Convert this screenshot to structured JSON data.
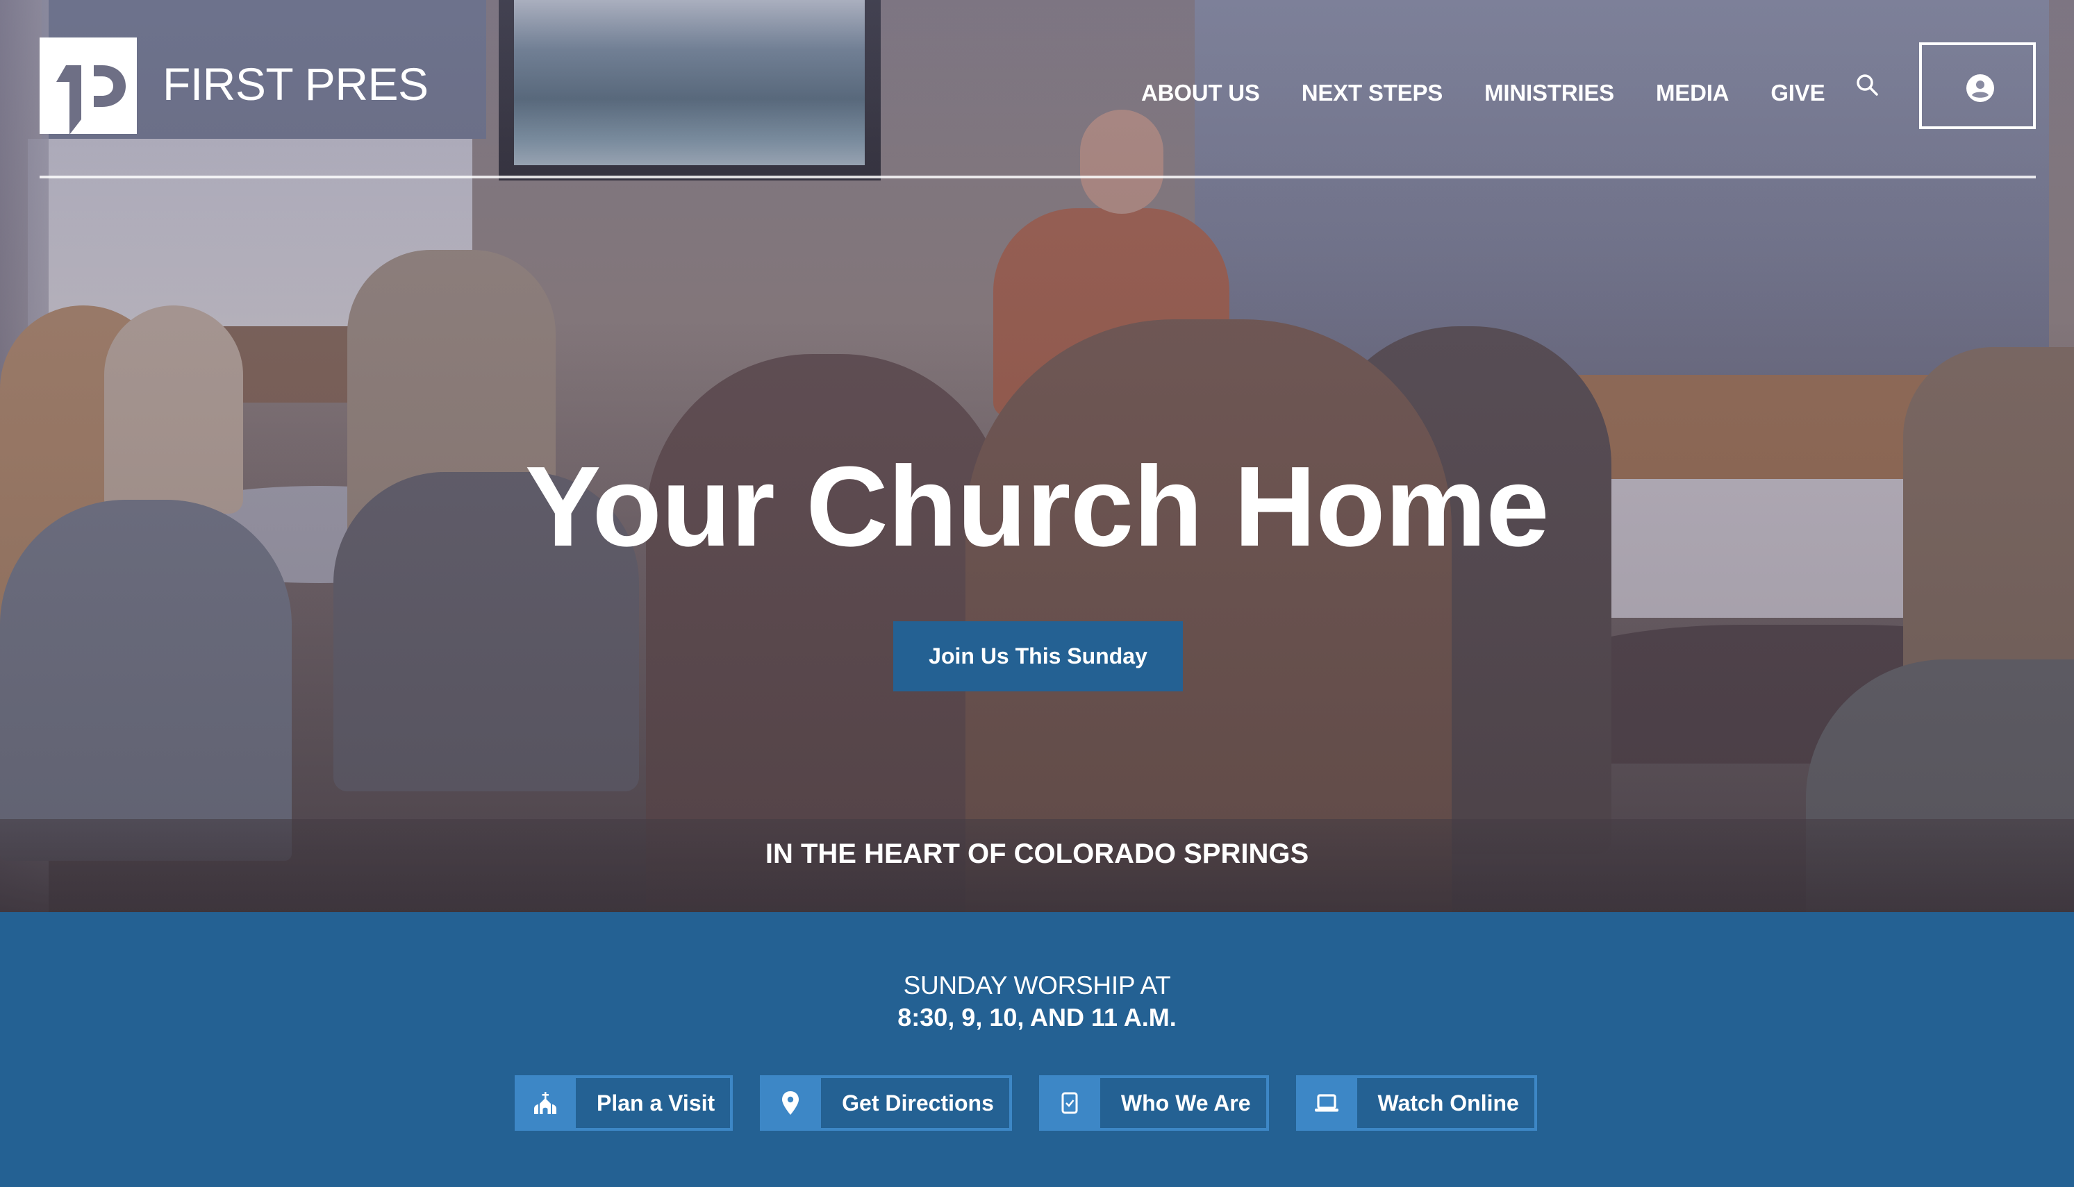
{
  "brand": {
    "name": "FIRST PRES",
    "logo_icon": "1p-monogram-icon"
  },
  "nav": {
    "items": [
      {
        "label": "ABOUT US"
      },
      {
        "label": "NEXT STEPS"
      },
      {
        "label": "MINISTRIES"
      },
      {
        "label": "MEDIA"
      },
      {
        "label": "GIVE"
      }
    ],
    "search_icon": "search-icon",
    "account_icon": "account-circle-icon"
  },
  "hero": {
    "headline": "Your Church Home",
    "cta_label": "Join Us This Sunday",
    "tagline": "IN THE HEART OF COLORADO SPRINGS"
  },
  "worship": {
    "label": "SUNDAY WORSHIP AT",
    "times": "8:30, 9, 10, AND 11 A.M."
  },
  "quick_links": [
    {
      "label": "Plan a Visit",
      "icon": "church-icon"
    },
    {
      "label": "Get Directions",
      "icon": "map-pin-icon"
    },
    {
      "label": "Who We Are",
      "icon": "checkbox-icon"
    },
    {
      "label": "Watch Online",
      "icon": "laptop-icon"
    }
  ],
  "colors": {
    "brand_blue": "#246193",
    "accent_blue": "#3d87c6",
    "text": "#ffffff"
  }
}
